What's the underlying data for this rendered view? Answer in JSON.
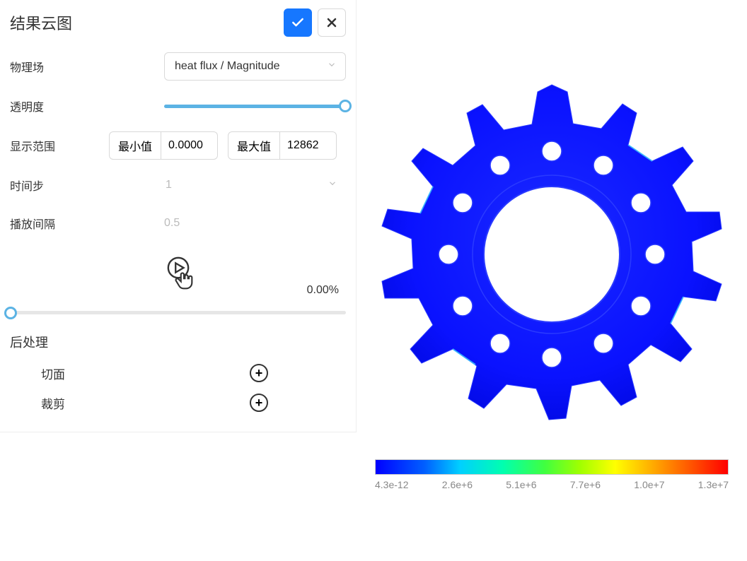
{
  "panel": {
    "title": "结果云图",
    "fields": {
      "physics_label": "物理场",
      "physics_value": "heat flux / Magnitude",
      "opacity_label": "透明度",
      "range_label": "显示范围",
      "range_min_label": "最小值",
      "range_min_value": "0.0000",
      "range_max_label": "最大值",
      "range_max_value": "12862",
      "timestep_label": "时间步",
      "timestep_value": "1",
      "interval_label": "播放间隔",
      "interval_value": "0.5",
      "percent": "0.00%"
    },
    "postprocess": {
      "title": "后处理",
      "section_label": "切面",
      "clip_label": "裁剪"
    }
  },
  "legend": {
    "values": [
      "4.3e-12",
      "2.6e+6",
      "5.1e+6",
      "7.7e+6",
      "1.0e+7",
      "1.3e+7"
    ]
  },
  "icons": {
    "check": "check-icon",
    "close": "close-icon",
    "chevron": "chevron-down-icon",
    "play": "play-icon",
    "plus": "plus-icon"
  },
  "colors": {
    "primary": "#1677ff",
    "accent": "#5bb3e4",
    "gear": "#0a12ff"
  }
}
